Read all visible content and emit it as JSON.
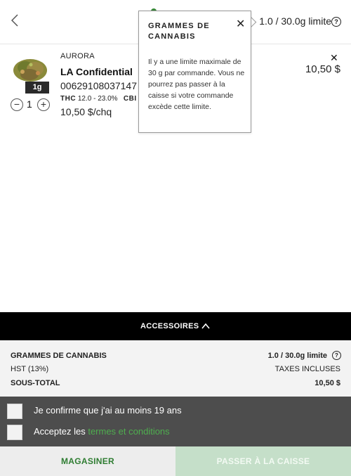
{
  "header": {
    "limit_text": "1.0 / 30.0g limite",
    "help_glyph": "?",
    "back_icon": "chevron-left-icon"
  },
  "product": {
    "brand": "AURORA",
    "name": "LA Confidential",
    "sku": "00629108037147",
    "thc_label": "THC",
    "thc_range": "12.0 - 23.0%",
    "cbd_label": "CBI",
    "size_badge": "1g",
    "quantity": "1",
    "unit_price": "10,50 $/chq",
    "line_price": "10,50 $",
    "remove_glyph": "✕"
  },
  "tooltip": {
    "title": "GRAMMES DE CANNABIS",
    "close_glyph": "✕",
    "body": "Il y a une limite maximale de 30 g par commande. Vous ne pourrez pas passer à la caisse si votre commande excède cette limite."
  },
  "accessories": {
    "label": "ACCESSOIRES"
  },
  "summary": {
    "cannabis_label": "GRAMMES DE CANNABIS",
    "cannabis_value": "1.0 / 30.0g limite",
    "tax_label": "HST (13%)",
    "tax_value": "TAXES INCLUSES",
    "subtotal_label": "SOUS-TOTAL",
    "subtotal_value": "10,50 $"
  },
  "confirm": {
    "age_label": "Je confirme que j'ai au moins 19 ans",
    "terms_prefix": "Acceptez les ",
    "terms_link": "termes et conditions"
  },
  "footer": {
    "shop_label": "MAGASINER",
    "checkout_label": "PASSER À LA CAISSE"
  },
  "colors": {
    "accent_green": "#2f7d32",
    "link_green": "#4fae4f",
    "checkout_disabled": "#c5dfc9",
    "accessories_bar": "#000000",
    "confirm_bg": "#4d4d4d"
  }
}
